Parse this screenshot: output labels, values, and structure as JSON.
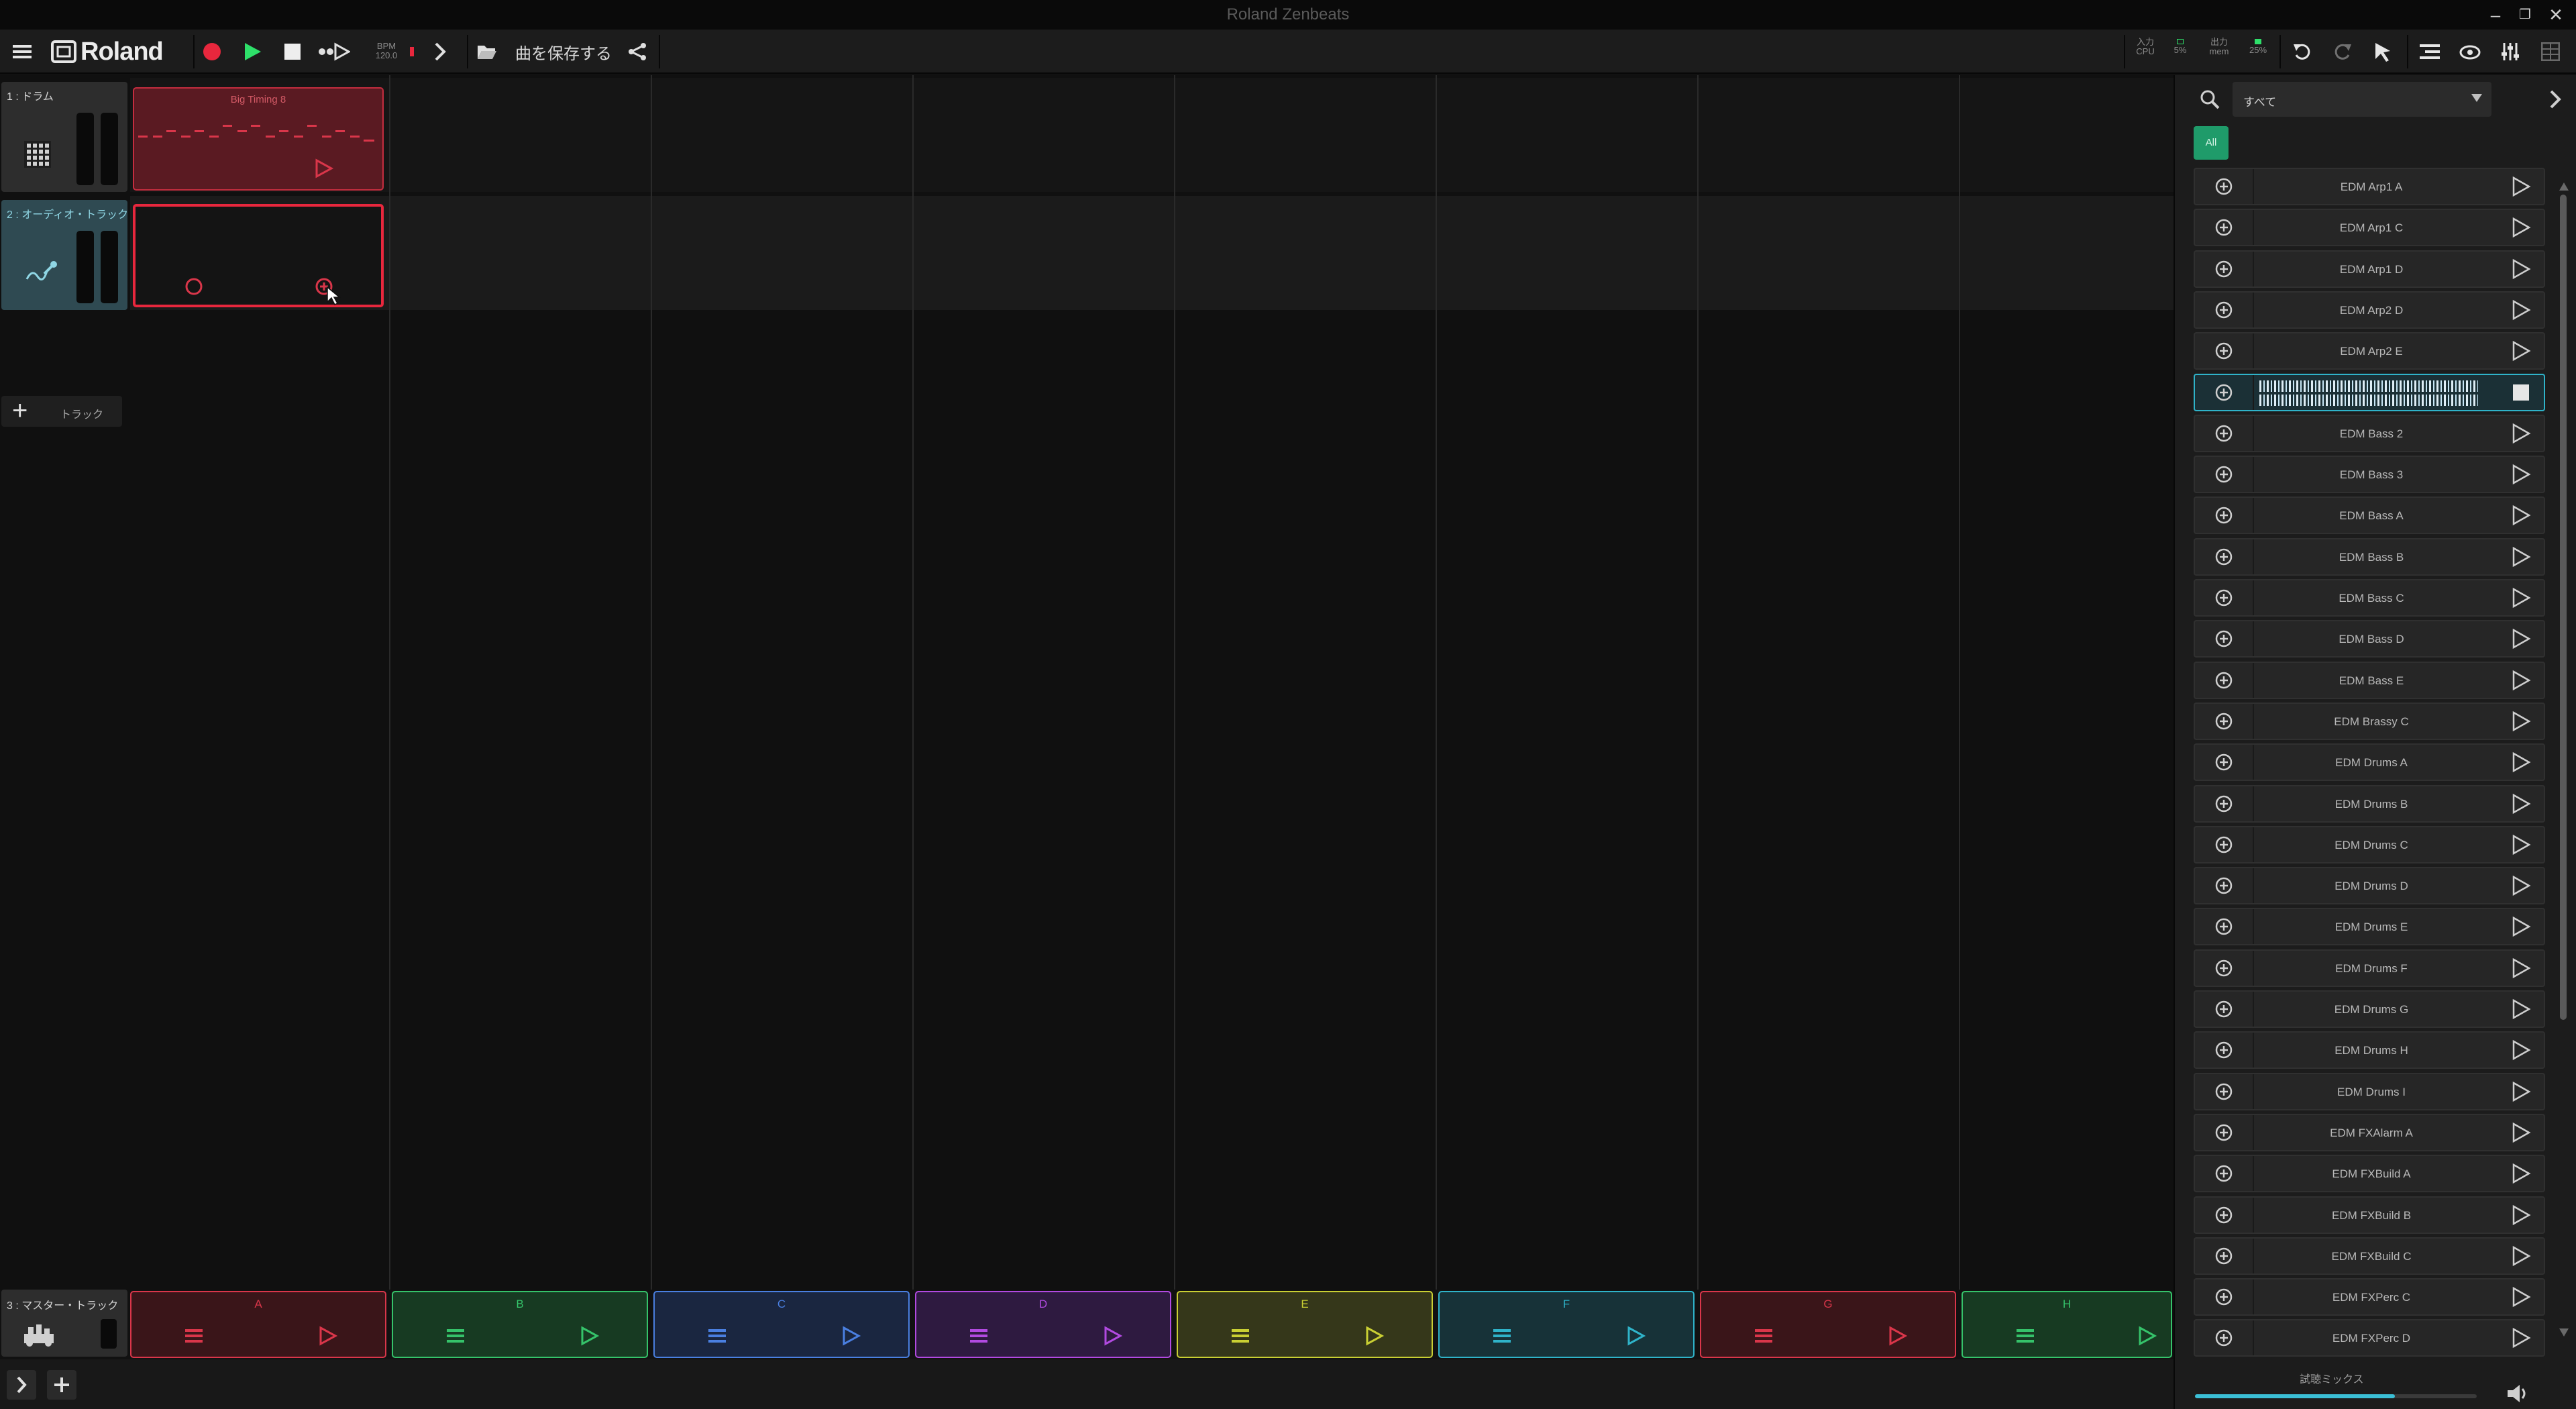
{
  "window": {
    "title": "Roland Zenbeats"
  },
  "toolbar": {
    "brand": "Roland",
    "bpm_label": "BPM",
    "bpm_value": "120.0",
    "save_label": "曲を保存する",
    "meters": {
      "in_label": "入力",
      "cpu_label": "CPU",
      "cpu_value": "5%",
      "out_label": "出力",
      "mem_label": "mem",
      "mem_value": "25%"
    }
  },
  "tracks": [
    {
      "name": "1 : ドラム",
      "icon": "drum-grid-icon"
    },
    {
      "name": "2 : オーディオ・トラック",
      "icon": "microphone-icon"
    }
  ],
  "clips": {
    "drum_clip_label": "Big Timing 8"
  },
  "add_track_label": "トラック",
  "master": {
    "name": "3 : マスター・トラック"
  },
  "scenes": [
    {
      "label": "A",
      "color": "#d9364a",
      "bg": "#3a1519"
    },
    {
      "label": "B",
      "color": "#35c26a",
      "bg": "#173a22"
    },
    {
      "label": "C",
      "color": "#4a7fe0",
      "bg": "#1a2640"
    },
    {
      "label": "D",
      "color": "#b14ae0",
      "bg": "#2e1a40"
    },
    {
      "label": "E",
      "color": "#c9cf33",
      "bg": "#35371a"
    },
    {
      "label": "F",
      "color": "#2fb3c9",
      "bg": "#173238"
    },
    {
      "label": "G",
      "color": "#d9364a",
      "bg": "#3a1519"
    },
    {
      "label": "H",
      "color": "#35c26a",
      "bg": "#173a22"
    }
  ],
  "browser": {
    "filter_value": "すべて",
    "tag_all": "All",
    "items": [
      "EDM Arp1 A",
      "EDM Arp1 C",
      "EDM Arp1 D",
      "EDM Arp2 D",
      "EDM Arp2 E",
      "",
      "EDM Bass 2",
      "EDM Bass 3",
      "EDM Bass A",
      "EDM Bass B",
      "EDM Bass C",
      "EDM Bass D",
      "EDM Bass E",
      "EDM Brassy C",
      "EDM Drums A",
      "EDM Drums B",
      "EDM Drums C",
      "EDM Drums D",
      "EDM Drums E",
      "EDM Drums F",
      "EDM Drums G",
      "EDM Drums H",
      "EDM Drums I",
      "EDM FXAlarm A",
      "EDM FXBuild A",
      "EDM FXBuild B",
      "EDM FXBuild C",
      "EDM FXPerc C",
      "EDM FXPerc D"
    ],
    "active_index": 5,
    "preview_mix_label": "試聴ミックス",
    "preview_mix_level": 0.71
  },
  "colors": {
    "accent_red": "#e8273d",
    "accent_green": "#2ee06a",
    "accent_teal": "#2fb3c9"
  }
}
